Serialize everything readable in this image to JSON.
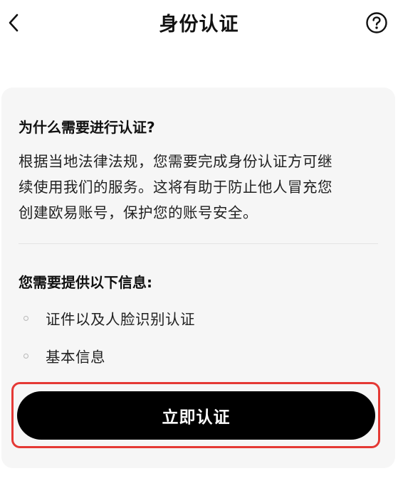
{
  "header": {
    "title": "身份认证",
    "back_icon": "chevron-left-icon",
    "help_icon": "question-circle-icon"
  },
  "why": {
    "heading": "为什么需要进行认证?",
    "lines": [
      "根据当地法律法规，您需要完成身份认证方可继",
      "续使用我们的服务。这将有助于防止他人冒充您",
      "创建欧易账号，保护您的账号安全。"
    ]
  },
  "requirements": {
    "heading": "您需要提供以下信息:",
    "items": [
      "证件以及人脸识别认证",
      "基本信息"
    ]
  },
  "cta": {
    "label": "立即认证"
  },
  "colors": {
    "card_bg": "#f6f6f6",
    "button_bg": "#000000",
    "highlight_border": "#e53935"
  }
}
